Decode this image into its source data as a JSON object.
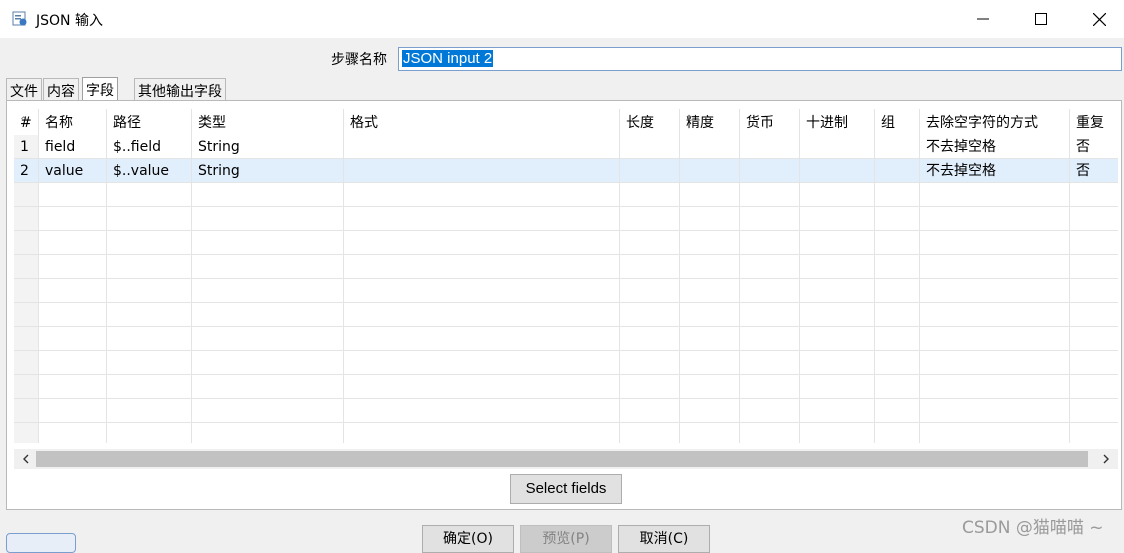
{
  "window": {
    "title": "JSON 输入",
    "icons": [
      "app-icon",
      "minimize-icon",
      "maximize-icon",
      "close-icon"
    ]
  },
  "step": {
    "label": "步骤名称",
    "value": "JSON input 2"
  },
  "tabs": [
    {
      "label": "文件",
      "active": false
    },
    {
      "label": "内容",
      "active": false
    },
    {
      "label": "字段",
      "active": true
    },
    {
      "label": "其他输出字段",
      "active": false
    }
  ],
  "table": {
    "columns": [
      "#",
      "名称",
      "路径",
      "类型",
      "格式",
      "长度",
      "精度",
      "货币",
      "十进制",
      "组",
      "去除空字符的方式",
      "重复"
    ],
    "rows": [
      [
        "1",
        "field",
        "$..field",
        "String",
        "",
        "",
        "",
        "",
        "",
        "",
        "不去掉空格",
        "否"
      ],
      [
        "2",
        "value",
        "$..value",
        "String",
        "",
        "",
        "",
        "",
        "",
        "",
        "不去掉空格",
        "否"
      ]
    ],
    "selected_row": 1
  },
  "select_fields_label": "Select fields",
  "buttons": {
    "ok": "确定(O)",
    "preview": "预览(P)",
    "cancel": "取消(C)"
  },
  "watermark": "CSDN @猫喵喵 ~"
}
